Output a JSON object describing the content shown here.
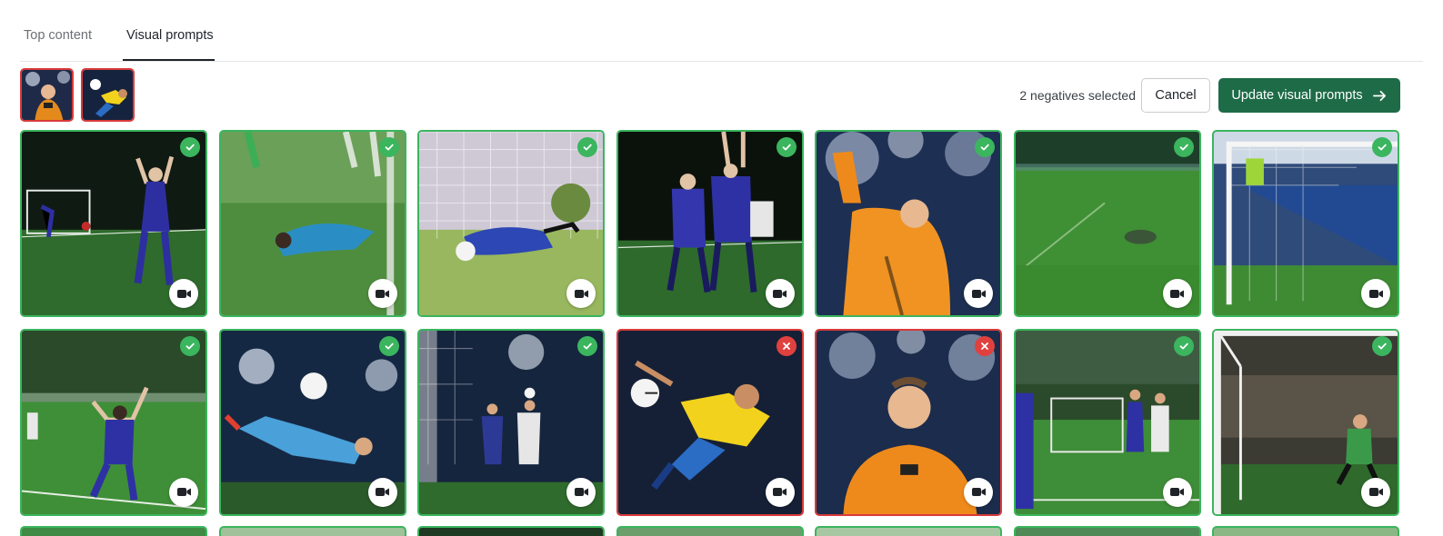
{
  "tabs": [
    {
      "label": "Top content",
      "active": false
    },
    {
      "label": "Visual prompts",
      "active": true
    }
  ],
  "negatives_strip": [
    {
      "name": "negative-thumb-goalkeeper",
      "status": "negative"
    },
    {
      "name": "negative-thumb-bicycle-kick",
      "status": "negative"
    }
  ],
  "toolbar": {
    "selection_text": "2 negatives selected",
    "cancel_label": "Cancel",
    "update_label": "Update visual prompts"
  },
  "colors": {
    "positive": "#3bb55e",
    "negative": "#d93a3a",
    "primary": "#1e6b47"
  },
  "icons": {
    "positive": "check-icon",
    "negative": "x-icon",
    "media": "video-camera-icon",
    "update": "arrow-right-icon"
  },
  "grid": {
    "columns": 7,
    "items": [
      {
        "scene": "night-celebration",
        "status": "positive",
        "media": "video"
      },
      {
        "scene": "blurred-dive",
        "status": "positive",
        "media": "video"
      },
      {
        "scene": "keeper-save-ground",
        "status": "positive",
        "media": "video"
      },
      {
        "scene": "two-players-celebrate",
        "status": "positive",
        "media": "video"
      },
      {
        "scene": "keeper-orange-pointing",
        "status": "positive",
        "media": "video"
      },
      {
        "scene": "blurred-grass",
        "status": "positive",
        "media": "video"
      },
      {
        "scene": "goal-post-stadium",
        "status": "positive",
        "media": "video"
      },
      {
        "scene": "player-arms-up",
        "status": "positive",
        "media": "video"
      },
      {
        "scene": "bicycle-kick-blue",
        "status": "positive",
        "media": "video"
      },
      {
        "scene": "stadium-header",
        "status": "positive",
        "media": "video"
      },
      {
        "scene": "bicycle-kick-yellow",
        "status": "negative",
        "media": "video"
      },
      {
        "scene": "keeper-orange-closeup",
        "status": "negative",
        "media": "video"
      },
      {
        "scene": "teammates-clapping",
        "status": "positive",
        "media": "video"
      },
      {
        "scene": "keeper-goal-crowd",
        "status": "positive",
        "media": "video"
      }
    ]
  }
}
